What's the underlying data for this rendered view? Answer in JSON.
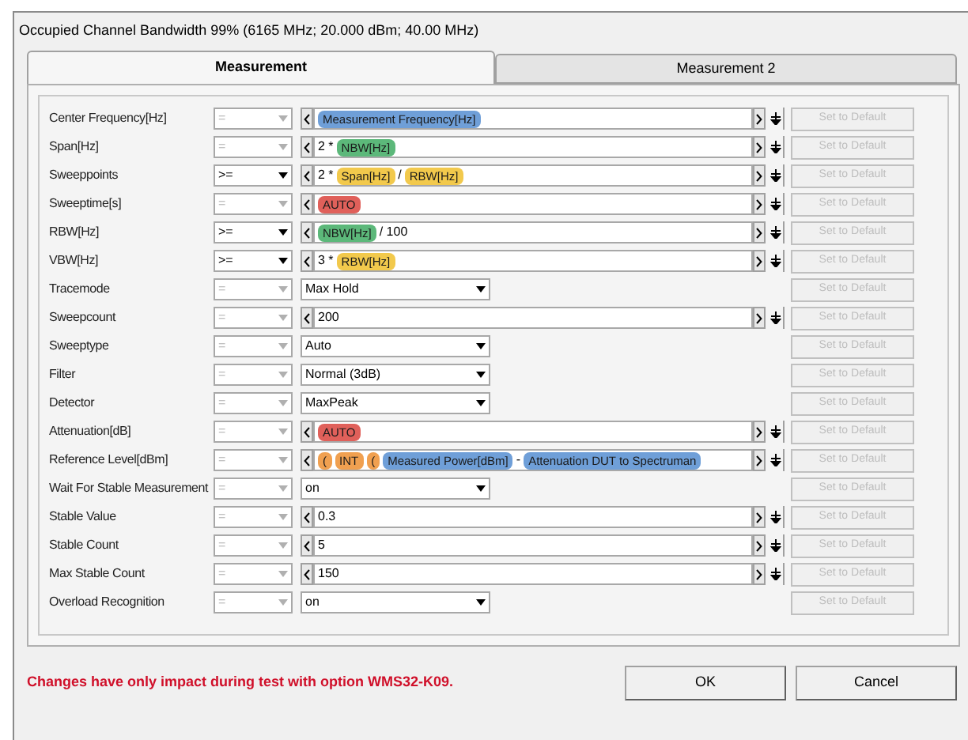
{
  "window": {
    "title": "Occupied Channel Bandwidth 99% (6165 MHz; 20.000 dBm; 40.00 MHz)"
  },
  "tabs": [
    {
      "label": "Measurement",
      "selected": true
    },
    {
      "label": "Measurement 2",
      "selected": false
    }
  ],
  "rows": [
    {
      "label": "Center Frequency[Hz]",
      "comparison": {
        "value": "=",
        "disabled": true
      },
      "kind": "expression",
      "parts": [
        {
          "kind": "token",
          "text": "Measurement Frequency[Hz]",
          "color": "#6f9fd8"
        }
      ],
      "default_button": {
        "label": "Set to Default",
        "disabled": true
      }
    },
    {
      "label": "Span[Hz]",
      "comparison": {
        "value": "=",
        "disabled": true
      },
      "kind": "expression",
      "parts": [
        {
          "kind": "text",
          "text": "2 *"
        },
        {
          "kind": "token",
          "text": "NBW[Hz]",
          "color": "#5cb87a"
        }
      ],
      "default_button": {
        "label": "Set to Default",
        "disabled": true
      }
    },
    {
      "label": "Sweeppoints",
      "comparison": {
        "value": ">=",
        "disabled": false
      },
      "kind": "expression",
      "parts": [
        {
          "kind": "text",
          "text": "2 *"
        },
        {
          "kind": "token",
          "text": "Span[Hz]",
          "color": "#f2c94c"
        },
        {
          "kind": "text",
          "text": "/"
        },
        {
          "kind": "token",
          "text": "RBW[Hz]",
          "color": "#f2c94c"
        }
      ],
      "default_button": {
        "label": "Set to Default",
        "disabled": true
      }
    },
    {
      "label": "Sweeptime[s]",
      "comparison": {
        "value": "=",
        "disabled": true
      },
      "kind": "expression",
      "parts": [
        {
          "kind": "token",
          "text": "AUTO",
          "color": "#e0605a"
        }
      ],
      "default_button": {
        "label": "Set to Default",
        "disabled": true
      }
    },
    {
      "label": "RBW[Hz]",
      "comparison": {
        "value": ">=",
        "disabled": false
      },
      "kind": "expression",
      "parts": [
        {
          "kind": "token",
          "text": "NBW[Hz]",
          "color": "#5cb87a"
        },
        {
          "kind": "text",
          "text": "/ 100"
        }
      ],
      "default_button": {
        "label": "Set to Default",
        "disabled": true
      }
    },
    {
      "label": "VBW[Hz]",
      "comparison": {
        "value": ">=",
        "disabled": false
      },
      "kind": "expression",
      "parts": [
        {
          "kind": "text",
          "text": "3 *"
        },
        {
          "kind": "token",
          "text": "RBW[Hz]",
          "color": "#f2c94c"
        }
      ],
      "default_button": {
        "label": "Set to Default",
        "disabled": true
      }
    },
    {
      "label": "Tracemode",
      "comparison": {
        "value": "=",
        "disabled": true
      },
      "kind": "select",
      "value": "Max Hold",
      "default_button": {
        "label": "Set to Default",
        "disabled": true
      }
    },
    {
      "label": "Sweepcount",
      "comparison": {
        "value": "=",
        "disabled": true
      },
      "kind": "expression",
      "parts": [
        {
          "kind": "text",
          "text": "200"
        }
      ],
      "default_button": {
        "label": "Set to Default",
        "disabled": true
      }
    },
    {
      "label": "Sweeptype",
      "comparison": {
        "value": "=",
        "disabled": true
      },
      "kind": "select",
      "value": "Auto",
      "default_button": {
        "label": "Set to Default",
        "disabled": true
      }
    },
    {
      "label": "Filter",
      "comparison": {
        "value": "=",
        "disabled": true
      },
      "kind": "select",
      "value": "Normal (3dB)",
      "default_button": {
        "label": "Set to Default",
        "disabled": true
      }
    },
    {
      "label": "Detector",
      "comparison": {
        "value": "=",
        "disabled": true
      },
      "kind": "select",
      "value": "MaxPeak",
      "default_button": {
        "label": "Set to Default",
        "disabled": true
      }
    },
    {
      "label": "Attenuation[dB]",
      "comparison": {
        "value": "=",
        "disabled": true
      },
      "kind": "expression",
      "parts": [
        {
          "kind": "token",
          "text": "AUTO",
          "color": "#e0605a"
        }
      ],
      "default_button": {
        "label": "Set to Default",
        "disabled": true
      }
    },
    {
      "label": "Reference Level[dBm]",
      "comparison": {
        "value": "=",
        "disabled": true
      },
      "kind": "expression",
      "parts": [
        {
          "kind": "token",
          "text": "(",
          "color": "#f0a050"
        },
        {
          "kind": "token",
          "text": "INT",
          "color": "#f0a050"
        },
        {
          "kind": "token",
          "text": "(",
          "color": "#f0a050"
        },
        {
          "kind": "token",
          "text": "Measured Power[dBm]",
          "color": "#6f9fd8"
        },
        {
          "kind": "text",
          "text": "-"
        },
        {
          "kind": "token",
          "text": "Attenuation DUT to Spectruman",
          "color": "#6f9fd8"
        }
      ],
      "default_button": {
        "label": "Set to Default",
        "disabled": true
      }
    },
    {
      "label": "Wait For Stable Measurement",
      "comparison": {
        "value": "=",
        "disabled": true
      },
      "kind": "select",
      "value": "on",
      "default_button": {
        "label": "Set to Default",
        "disabled": true
      }
    },
    {
      "label": "Stable Value",
      "comparison": {
        "value": "=",
        "disabled": true
      },
      "kind": "expression",
      "parts": [
        {
          "kind": "text",
          "text": "0.3"
        }
      ],
      "default_button": {
        "label": "Set to Default",
        "disabled": true
      }
    },
    {
      "label": "Stable Count",
      "comparison": {
        "value": "=",
        "disabled": true
      },
      "kind": "expression",
      "parts": [
        {
          "kind": "text",
          "text": "5"
        }
      ],
      "default_button": {
        "label": "Set to Default",
        "disabled": true
      }
    },
    {
      "label": "Max Stable Count",
      "comparison": {
        "value": "=",
        "disabled": true
      },
      "kind": "expression",
      "parts": [
        {
          "kind": "text",
          "text": "150"
        }
      ],
      "default_button": {
        "label": "Set to Default",
        "disabled": true
      }
    },
    {
      "label": "Overload Recognition",
      "comparison": {
        "value": "=",
        "disabled": true
      },
      "kind": "select",
      "value": "on",
      "default_button": {
        "label": "Set to Default",
        "disabled": true
      }
    }
  ],
  "footer": {
    "note": "Changes have only impact during test with option WMS32-K09.",
    "buttons": [
      "OK",
      "Cancel"
    ]
  }
}
